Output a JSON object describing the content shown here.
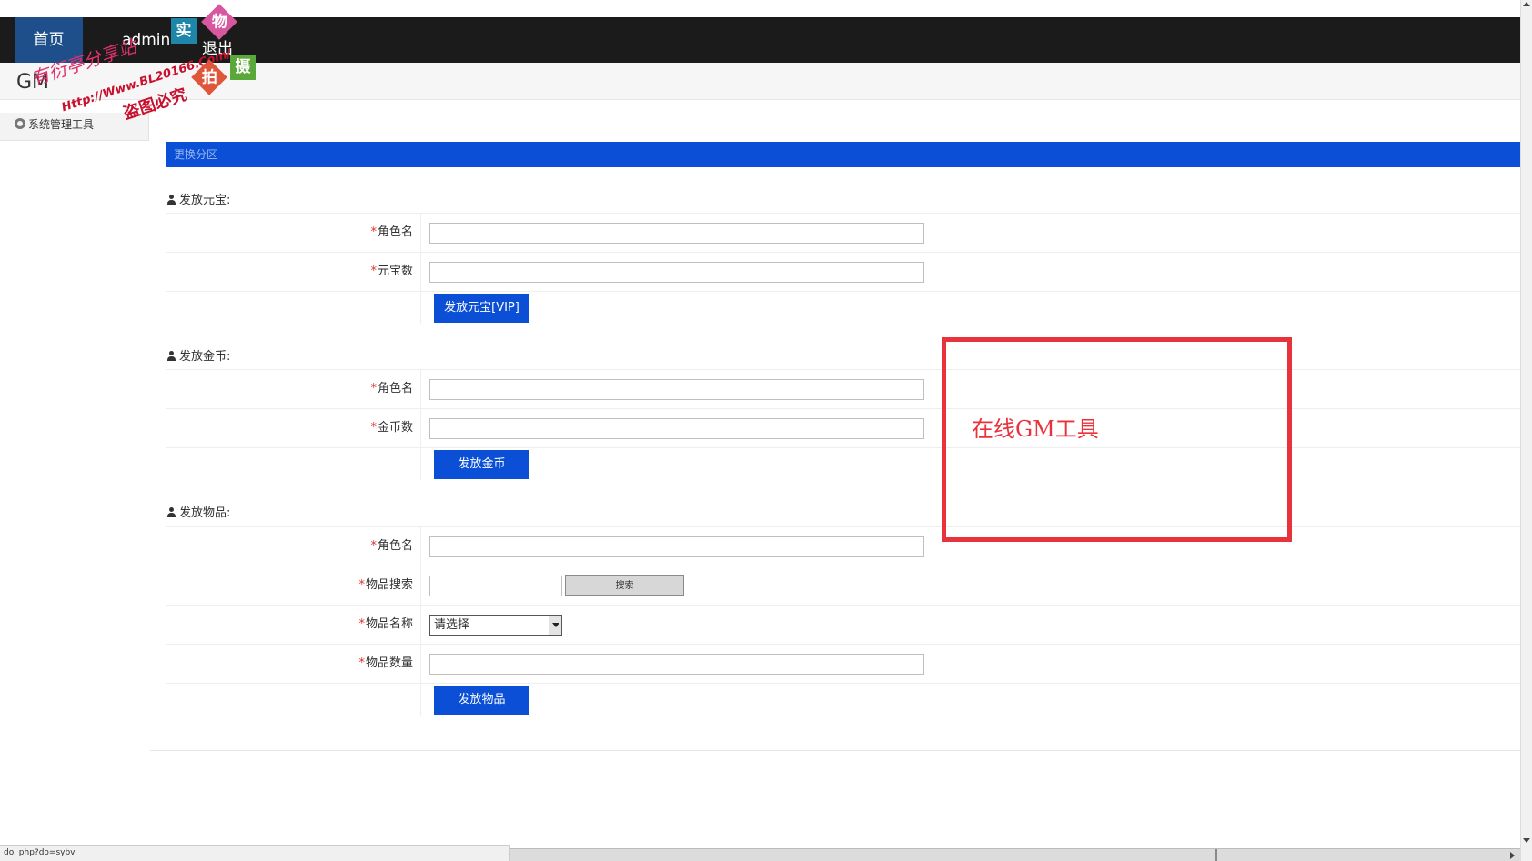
{
  "nav": {
    "home": "首页",
    "user": "admin",
    "logout": "退出"
  },
  "brand": {
    "title": "GM"
  },
  "sidebar": {
    "items": [
      {
        "label": "系统管理工具",
        "icon": "gear-icon"
      }
    ]
  },
  "section_bar": {
    "label": "更换分区"
  },
  "forms": {
    "yuanbao": {
      "title": "发放元宝:",
      "fields": [
        {
          "label": "角色名",
          "value": ""
        },
        {
          "label": "元宝数",
          "value": ""
        }
      ],
      "submit": "发放元宝[VIP]"
    },
    "gold": {
      "title": "发放金币:",
      "fields": [
        {
          "label": "角色名",
          "value": ""
        },
        {
          "label": "金币数",
          "value": ""
        }
      ],
      "submit": "发放金币"
    },
    "item": {
      "title": "发放物品:",
      "fields": [
        {
          "label": "角色名",
          "value": ""
        },
        {
          "label": "物品搜索",
          "value": ""
        },
        {
          "label": "物品名称",
          "selected": "请选择"
        },
        {
          "label": "物品数量",
          "value": ""
        }
      ],
      "search_button": "搜索",
      "submit": "发放物品"
    }
  },
  "required_mark": "*",
  "annotation": {
    "text": "在线GM工具",
    "color": "#e8333c"
  },
  "watermark": {
    "line1": "有衍亭分享站",
    "line2": "Http://Www.BL20166.Com/",
    "line3": "盗图必究",
    "stamps": [
      "实",
      "物",
      "拍",
      "摄"
    ]
  },
  "status_bar": {
    "text": "do. php?do=sybv"
  },
  "colors": {
    "nav_bg": "#1b1b1b",
    "nav_active": "#1e4f8a",
    "primary": "#0a4fd6",
    "required": "#e03030"
  }
}
